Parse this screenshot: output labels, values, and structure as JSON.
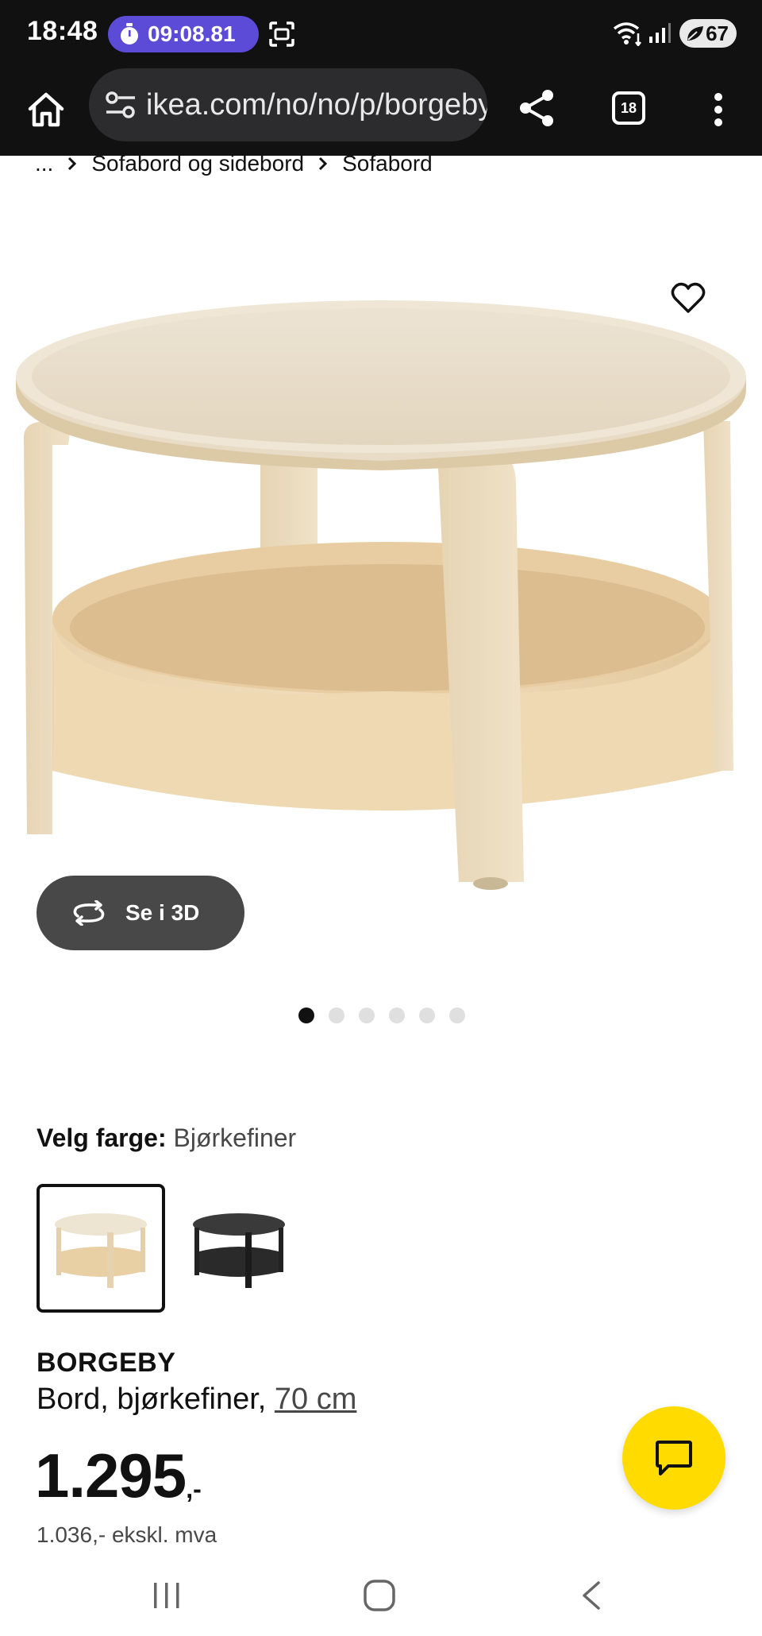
{
  "status_bar": {
    "time": "18:48",
    "timer": "09:08.81",
    "battery": "67"
  },
  "browser": {
    "url": "ikea.com/no/no/p/borgeby-bord",
    "tabs_count": "18"
  },
  "breadcrumb": {
    "items": [
      "...",
      "Sofabord og sidebord",
      "Sofabord"
    ]
  },
  "gallery": {
    "view_3d_label": "Se i 3D",
    "image_count": 6,
    "active_index": 0
  },
  "product": {
    "color_label": "Velg farge:",
    "color_value": "Bjørkefiner",
    "name": "BORGEBY",
    "description": "Bord, bjørkefiner, ",
    "size_link": "70 cm",
    "price": "1.295",
    "price_suffix": ",-",
    "price_ex_vat": "1.036,- ekskl. mva"
  },
  "colors": {
    "birch": "#e8d6b8",
    "black": "#2a2a2a",
    "accent_yellow": "#ffdb00"
  }
}
